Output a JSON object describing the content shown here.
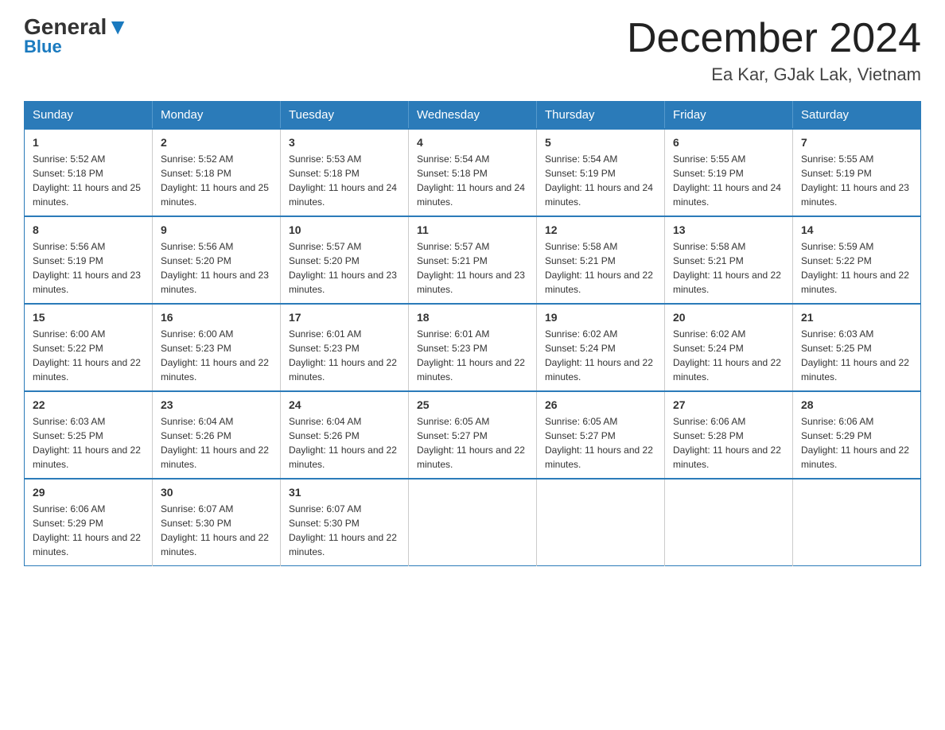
{
  "header": {
    "logo_general": "General",
    "logo_blue": "Blue",
    "title": "December 2024",
    "subtitle": "Ea Kar, GJak Lak, Vietnam"
  },
  "days_of_week": [
    "Sunday",
    "Monday",
    "Tuesday",
    "Wednesday",
    "Thursday",
    "Friday",
    "Saturday"
  ],
  "weeks": [
    [
      {
        "day": "1",
        "sunrise": "5:52 AM",
        "sunset": "5:18 PM",
        "daylight": "11 hours and 25 minutes."
      },
      {
        "day": "2",
        "sunrise": "5:52 AM",
        "sunset": "5:18 PM",
        "daylight": "11 hours and 25 minutes."
      },
      {
        "day": "3",
        "sunrise": "5:53 AM",
        "sunset": "5:18 PM",
        "daylight": "11 hours and 24 minutes."
      },
      {
        "day": "4",
        "sunrise": "5:54 AM",
        "sunset": "5:18 PM",
        "daylight": "11 hours and 24 minutes."
      },
      {
        "day": "5",
        "sunrise": "5:54 AM",
        "sunset": "5:19 PM",
        "daylight": "11 hours and 24 minutes."
      },
      {
        "day": "6",
        "sunrise": "5:55 AM",
        "sunset": "5:19 PM",
        "daylight": "11 hours and 24 minutes."
      },
      {
        "day": "7",
        "sunrise": "5:55 AM",
        "sunset": "5:19 PM",
        "daylight": "11 hours and 23 minutes."
      }
    ],
    [
      {
        "day": "8",
        "sunrise": "5:56 AM",
        "sunset": "5:19 PM",
        "daylight": "11 hours and 23 minutes."
      },
      {
        "day": "9",
        "sunrise": "5:56 AM",
        "sunset": "5:20 PM",
        "daylight": "11 hours and 23 minutes."
      },
      {
        "day": "10",
        "sunrise": "5:57 AM",
        "sunset": "5:20 PM",
        "daylight": "11 hours and 23 minutes."
      },
      {
        "day": "11",
        "sunrise": "5:57 AM",
        "sunset": "5:21 PM",
        "daylight": "11 hours and 23 minutes."
      },
      {
        "day": "12",
        "sunrise": "5:58 AM",
        "sunset": "5:21 PM",
        "daylight": "11 hours and 22 minutes."
      },
      {
        "day": "13",
        "sunrise": "5:58 AM",
        "sunset": "5:21 PM",
        "daylight": "11 hours and 22 minutes."
      },
      {
        "day": "14",
        "sunrise": "5:59 AM",
        "sunset": "5:22 PM",
        "daylight": "11 hours and 22 minutes."
      }
    ],
    [
      {
        "day": "15",
        "sunrise": "6:00 AM",
        "sunset": "5:22 PM",
        "daylight": "11 hours and 22 minutes."
      },
      {
        "day": "16",
        "sunrise": "6:00 AM",
        "sunset": "5:23 PM",
        "daylight": "11 hours and 22 minutes."
      },
      {
        "day": "17",
        "sunrise": "6:01 AM",
        "sunset": "5:23 PM",
        "daylight": "11 hours and 22 minutes."
      },
      {
        "day": "18",
        "sunrise": "6:01 AM",
        "sunset": "5:23 PM",
        "daylight": "11 hours and 22 minutes."
      },
      {
        "day": "19",
        "sunrise": "6:02 AM",
        "sunset": "5:24 PM",
        "daylight": "11 hours and 22 minutes."
      },
      {
        "day": "20",
        "sunrise": "6:02 AM",
        "sunset": "5:24 PM",
        "daylight": "11 hours and 22 minutes."
      },
      {
        "day": "21",
        "sunrise": "6:03 AM",
        "sunset": "5:25 PM",
        "daylight": "11 hours and 22 minutes."
      }
    ],
    [
      {
        "day": "22",
        "sunrise": "6:03 AM",
        "sunset": "5:25 PM",
        "daylight": "11 hours and 22 minutes."
      },
      {
        "day": "23",
        "sunrise": "6:04 AM",
        "sunset": "5:26 PM",
        "daylight": "11 hours and 22 minutes."
      },
      {
        "day": "24",
        "sunrise": "6:04 AM",
        "sunset": "5:26 PM",
        "daylight": "11 hours and 22 minutes."
      },
      {
        "day": "25",
        "sunrise": "6:05 AM",
        "sunset": "5:27 PM",
        "daylight": "11 hours and 22 minutes."
      },
      {
        "day": "26",
        "sunrise": "6:05 AM",
        "sunset": "5:27 PM",
        "daylight": "11 hours and 22 minutes."
      },
      {
        "day": "27",
        "sunrise": "6:06 AM",
        "sunset": "5:28 PM",
        "daylight": "11 hours and 22 minutes."
      },
      {
        "day": "28",
        "sunrise": "6:06 AM",
        "sunset": "5:29 PM",
        "daylight": "11 hours and 22 minutes."
      }
    ],
    [
      {
        "day": "29",
        "sunrise": "6:06 AM",
        "sunset": "5:29 PM",
        "daylight": "11 hours and 22 minutes."
      },
      {
        "day": "30",
        "sunrise": "6:07 AM",
        "sunset": "5:30 PM",
        "daylight": "11 hours and 22 minutes."
      },
      {
        "day": "31",
        "sunrise": "6:07 AM",
        "sunset": "5:30 PM",
        "daylight": "11 hours and 22 minutes."
      },
      null,
      null,
      null,
      null
    ]
  ],
  "labels": {
    "sunrise_prefix": "Sunrise: ",
    "sunset_prefix": "Sunset: ",
    "daylight_prefix": "Daylight: "
  }
}
